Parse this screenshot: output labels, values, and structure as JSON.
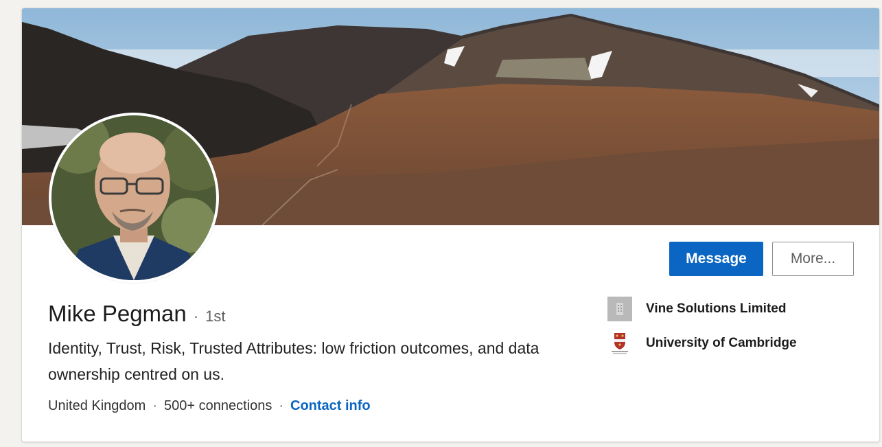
{
  "profile": {
    "name": "Mike Pegman",
    "degree": "1st",
    "headline": "Identity, Trust, Risk, Trusted Attributes: low friction outcomes, and data ownership centred on us.",
    "location": "United Kingdom",
    "connections": "500+ connections",
    "contact_label": "Contact info",
    "separator": "·"
  },
  "actions": {
    "message_label": "Message",
    "more_label": "More..."
  },
  "experience": [
    {
      "name": "Vine Solutions Limited",
      "icon": "building-icon"
    },
    {
      "name": "University of Cambridge",
      "icon": "cambridge-crest-icon"
    }
  ],
  "colors": {
    "accent": "#0a66c2",
    "page_bg": "#f3f2ef",
    "card_bg": "#ffffff"
  }
}
